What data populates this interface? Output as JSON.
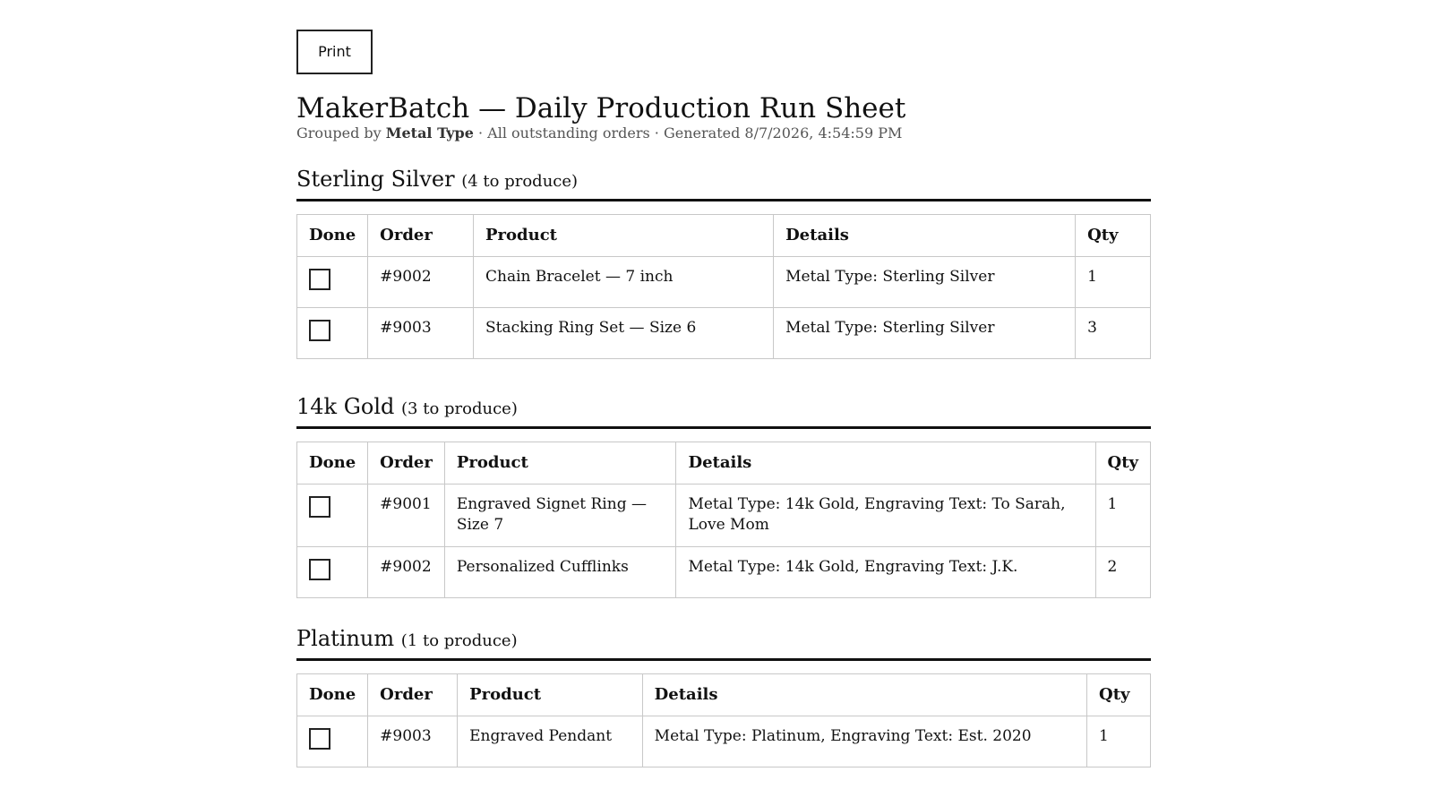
{
  "toolbar": {
    "print_label": "Print"
  },
  "header": {
    "title": "MakerBatch — Daily Production Run Sheet",
    "grouped_by_prefix": "Grouped by ",
    "grouped_by": "Metal Type",
    "meta": " · All outstanding orders · Generated 8/7/2026, 4:54:59 PM"
  },
  "columns": [
    "Done",
    "Order",
    "Product",
    "Details",
    "Qty"
  ],
  "groups": [
    {
      "name": "Sterling Silver",
      "count_text": "(4 to produce)",
      "rows": [
        {
          "order": "#9002",
          "product": "Chain Bracelet — 7 inch",
          "details": "Metal Type: Sterling Silver",
          "qty": "1"
        },
        {
          "order": "#9003",
          "product": "Stacking Ring Set — Size 6",
          "details": "Metal Type: Sterling Silver",
          "qty": "3"
        }
      ]
    },
    {
      "name": "14k Gold",
      "count_text": "(3 to produce)",
      "rows": [
        {
          "order": "#9001",
          "product": "Engraved Signet Ring — Size 7",
          "details": "Metal Type: 14k Gold, Engraving Text: To Sarah, Love Mom",
          "qty": "1"
        },
        {
          "order": "#9002",
          "product": "Personalized Cufflinks",
          "details": "Metal Type: 14k Gold, Engraving Text: J.K.",
          "qty": "2"
        }
      ]
    },
    {
      "name": "Platinum",
      "count_text": "(1 to produce)",
      "rows": [
        {
          "order": "#9003",
          "product": "Engraved Pendant",
          "details": "Metal Type: Platinum, Engraving Text: Est. 2020",
          "qty": "1"
        }
      ]
    }
  ]
}
